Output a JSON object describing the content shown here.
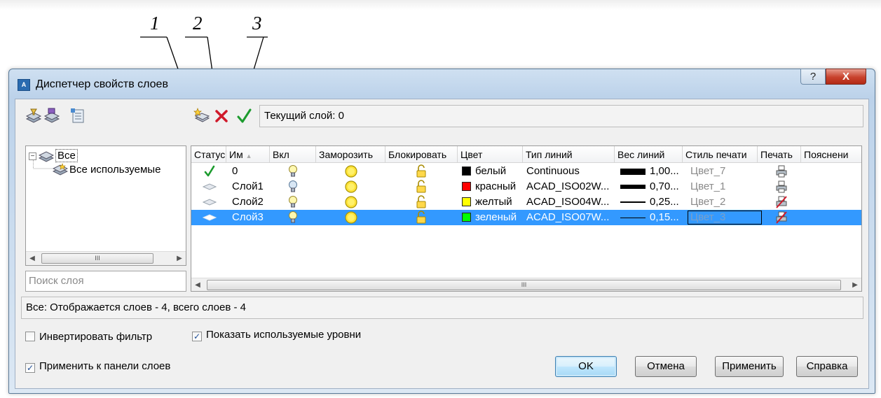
{
  "callouts": [
    "1",
    "2",
    "3"
  ],
  "window": {
    "title": "Диспетчер свойств слоев",
    "help_label": "?",
    "close_label": "X"
  },
  "toolbar": {
    "icons": [
      "new-property-filter-icon",
      "new-group-filter-icon",
      "layer-states-manager-icon",
      "new-layer-icon",
      "delete-layer-icon",
      "set-current-icon"
    ],
    "current_layer": "Текущий слой: 0"
  },
  "tree": {
    "root": "Все",
    "child": "Все используемые"
  },
  "search": {
    "placeholder": "Поиск слоя"
  },
  "table": {
    "columns": [
      "Статус",
      "Им",
      "Вкл",
      "Заморозить",
      "Блокировать",
      "Цвет",
      "Тип линий",
      "Вес линий",
      "Стиль печати",
      "Печать",
      "Пояснени"
    ],
    "rows": [
      {
        "status": "current",
        "name": "0",
        "color_name": "белый",
        "color_hex": "#000000",
        "linetype": "Continuous",
        "lineweight": "1,00...",
        "plot_style": "Цвет_7",
        "plot": "printer"
      },
      {
        "status": "layer",
        "name": "Слой1",
        "color_name": "красный",
        "color_hex": "#ff0000",
        "linetype": "ACAD_ISO02W...",
        "lineweight": "0,70...",
        "plot_style": "Цвет_1",
        "plot": "printer"
      },
      {
        "status": "layer",
        "name": "Слой2",
        "color_name": "желтый",
        "color_hex": "#ffff00",
        "linetype": "ACAD_ISO04W...",
        "lineweight": "0,25...",
        "plot_style": "Цвет_2",
        "plot": "no-plot"
      },
      {
        "status": "layer",
        "name": "Слой3",
        "color_name": "зеленый",
        "color_hex": "#00ff00",
        "linetype": "ACAD_ISO07W...",
        "lineweight": "0,15...",
        "plot_style": "Цвет_3",
        "plot": "no-plot",
        "selected": true
      }
    ]
  },
  "status_text": "Все: Отображается слоев - 4, всего слоев - 4",
  "options": {
    "invert_filter": {
      "label": "Инвертировать фильтр",
      "checked": false
    },
    "show_used": {
      "label": "Показать используемые уровни",
      "checked": true
    },
    "apply_to_toolbar": {
      "label": "Применить к панели слоев",
      "checked": true
    }
  },
  "buttons": {
    "ok": "OK",
    "cancel": "Отмена",
    "apply": "Применить",
    "help": "Справка"
  },
  "scroll_glyph": "III"
}
